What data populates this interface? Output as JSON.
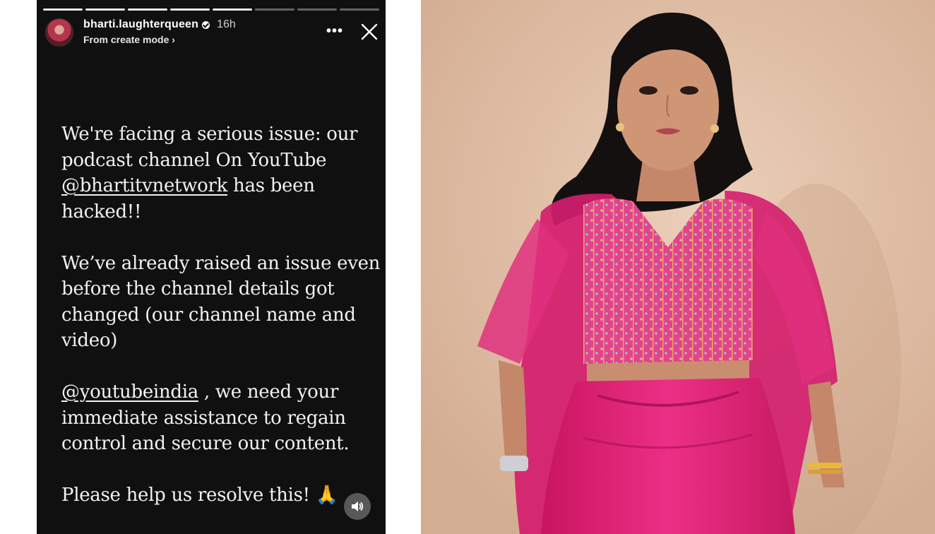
{
  "story": {
    "username": "bharti.laughterqueen",
    "time_ago": "16h",
    "subtitle": "From create mode ›",
    "more_icon": "more-horizontal-icon",
    "close_icon": "close-icon",
    "segments_total": 8,
    "segments_done": 5,
    "paragraphs": [
      {
        "parts": [
          {
            "text": "We're facing a serious issue: our podcast channel On YouTube "
          },
          {
            "text": "@bhartitvnetwork",
            "mention": true
          },
          {
            "text": " has been hacked!!"
          }
        ]
      },
      {
        "parts": [
          {
            "text": "We’ve already raised an issue even before the channel details got changed (our channel name and video)"
          }
        ]
      },
      {
        "parts": [
          {
            "text": "@youtubeindia",
            "mention": true
          },
          {
            "text": " , we need your immediate assistance to regain control and secure our content."
          }
        ]
      },
      {
        "parts": [
          {
            "text": "Please help us resolve this! 🙏"
          }
        ]
      }
    ],
    "sound_icon": "speaker-icon"
  },
  "photo": {
    "subject": "woman-in-pink-outfit",
    "colors": {
      "background": "#e3c2aa",
      "outfit": "#e0247a",
      "hair": "#141010",
      "skin": "#c98e6f"
    }
  }
}
